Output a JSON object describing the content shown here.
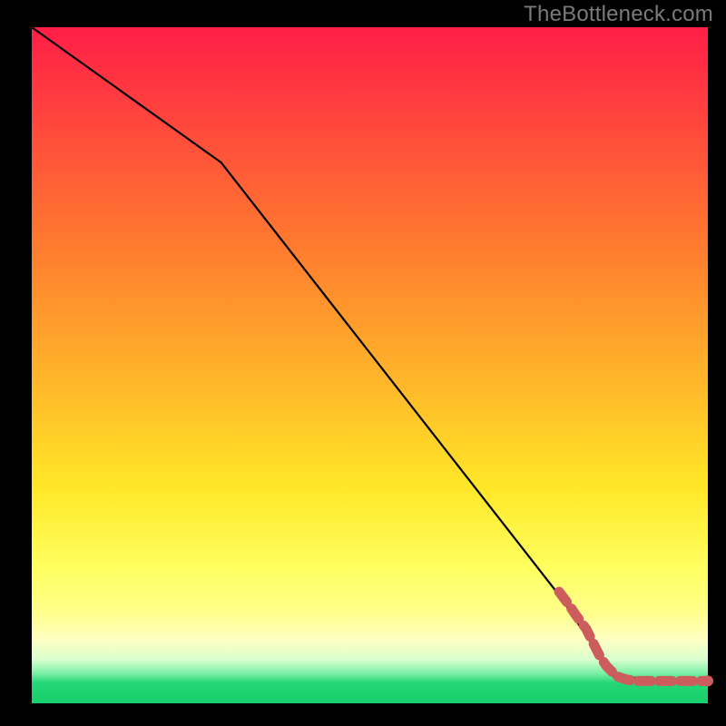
{
  "watermark": "TheBottleneck.com",
  "chart_data": {
    "type": "line",
    "title": "",
    "xlabel": "",
    "ylabel": "",
    "xlim": [
      0,
      100
    ],
    "ylim": [
      0,
      100
    ],
    "gradient_colors": {
      "top": "#ff1e47",
      "mid_upper": "#ff9a2a",
      "mid": "#ffe727",
      "mid_lower": "#ffff8a",
      "band_yellow": "#ffffc2",
      "green": "#24d676",
      "bottom_green": "#18cf6b"
    },
    "series": [
      {
        "name": "curve",
        "style": "solid-black",
        "points": [
          {
            "x": 0,
            "y": 100
          },
          {
            "x": 28,
            "y": 80
          },
          {
            "x": 78,
            "y": 16
          },
          {
            "x": 86,
            "y": 4
          },
          {
            "x": 100,
            "y": 3
          }
        ]
      },
      {
        "name": "highlight-dots",
        "style": "salmon-dots",
        "points": [
          {
            "x": 78,
            "y": 16.5
          },
          {
            "x": 79.5,
            "y": 14.5
          },
          {
            "x": 80.5,
            "y": 13
          },
          {
            "x": 82,
            "y": 11
          },
          {
            "x": 83,
            "y": 9
          },
          {
            "x": 84,
            "y": 7
          },
          {
            "x": 85,
            "y": 5.5
          },
          {
            "x": 86.5,
            "y": 4
          },
          {
            "x": 88,
            "y": 3.5
          },
          {
            "x": 89.5,
            "y": 3.3
          },
          {
            "x": 91,
            "y": 3.3
          },
          {
            "x": 93,
            "y": 3.3
          },
          {
            "x": 95,
            "y": 3.3
          },
          {
            "x": 97,
            "y": 3.3
          },
          {
            "x": 100,
            "y": 3.3
          }
        ]
      }
    ]
  }
}
